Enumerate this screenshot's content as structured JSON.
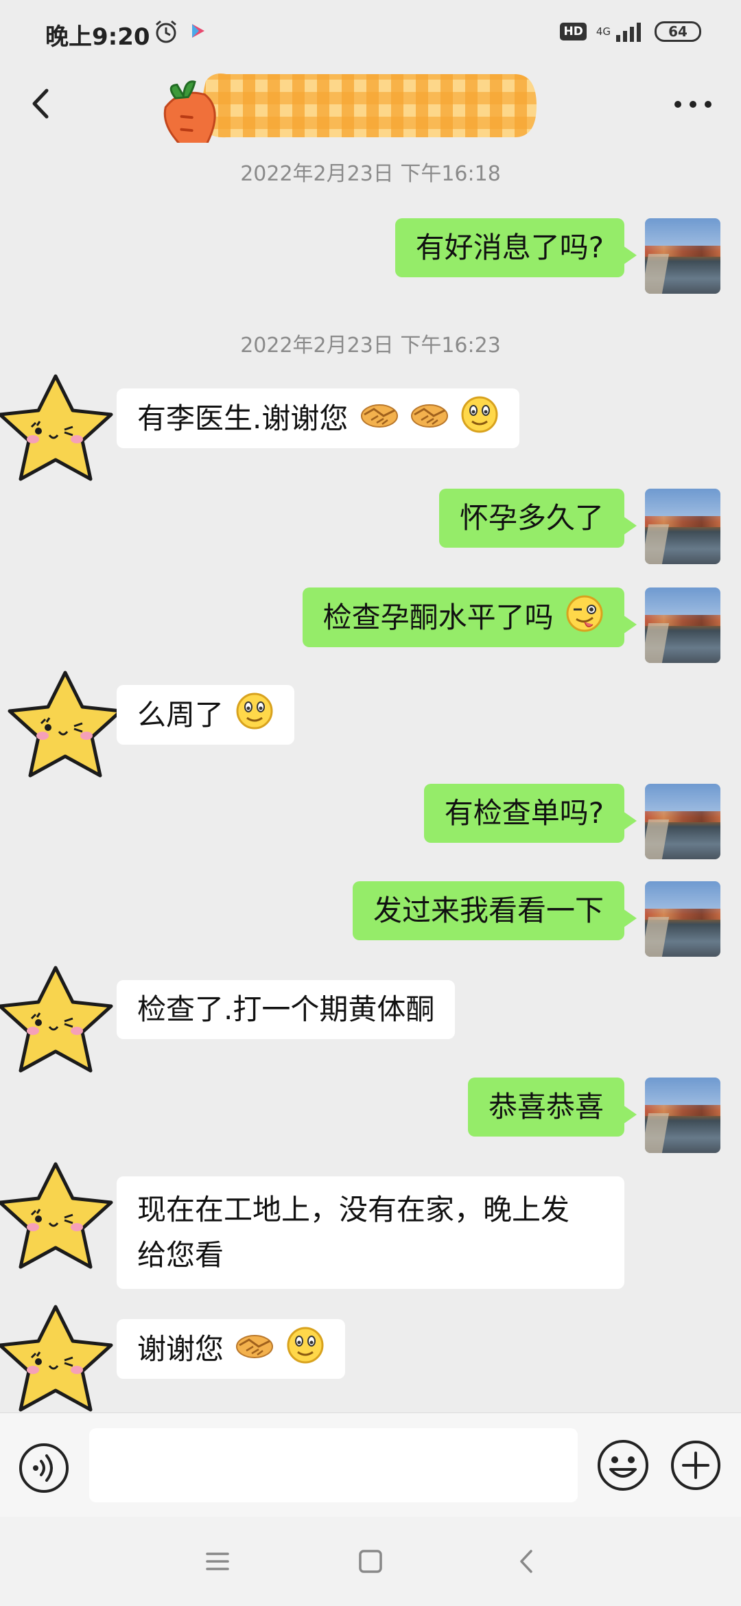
{
  "status_bar": {
    "time": "晚上9:20",
    "hd_label": "HD",
    "network_label": "4G",
    "battery_level": "64"
  },
  "nav": {
    "contact_name": "",
    "back_icon": "chevron-left-icon",
    "more_icon": "more-dots-icon"
  },
  "messages": [
    {
      "type": "timestamp",
      "text": "2022年2月23日 下午16:18"
    },
    {
      "type": "outgoing",
      "text": "有好消息了吗?"
    },
    {
      "type": "timestamp",
      "text": "2022年2月23日 下午16:23"
    },
    {
      "type": "incoming",
      "text": "有李医生.谢谢您",
      "emojis": [
        "handshake",
        "handshake",
        "smile"
      ]
    },
    {
      "type": "outgoing",
      "text": "怀孕多久了"
    },
    {
      "type": "outgoing",
      "text": "检查孕酮水平了吗",
      "emojis": [
        "wink-tongue"
      ]
    },
    {
      "type": "incoming",
      "text": "么周了",
      "emojis": [
        "smile"
      ]
    },
    {
      "type": "outgoing",
      "text": "有检查单吗?"
    },
    {
      "type": "outgoing",
      "text": "发过来我看看一下"
    },
    {
      "type": "incoming",
      "text": "检查了.打一个期黄体酮"
    },
    {
      "type": "outgoing",
      "text": "恭喜恭喜"
    },
    {
      "type": "incoming",
      "text_line1": "现在在工地上，没有在家，晚上发",
      "text_line2": "给您看"
    },
    {
      "type": "incoming",
      "text": "谢谢您",
      "emojis": [
        "handshake",
        "smile"
      ]
    }
  ],
  "input_bar": {
    "placeholder": "",
    "voice_icon": "voice-icon",
    "emoji_icon": "emoji-icon",
    "plus_icon": "plus-icon"
  },
  "colors": {
    "outgoing_bubble": "#95ec69",
    "incoming_bubble": "#ffffff",
    "background": "#ededed"
  }
}
